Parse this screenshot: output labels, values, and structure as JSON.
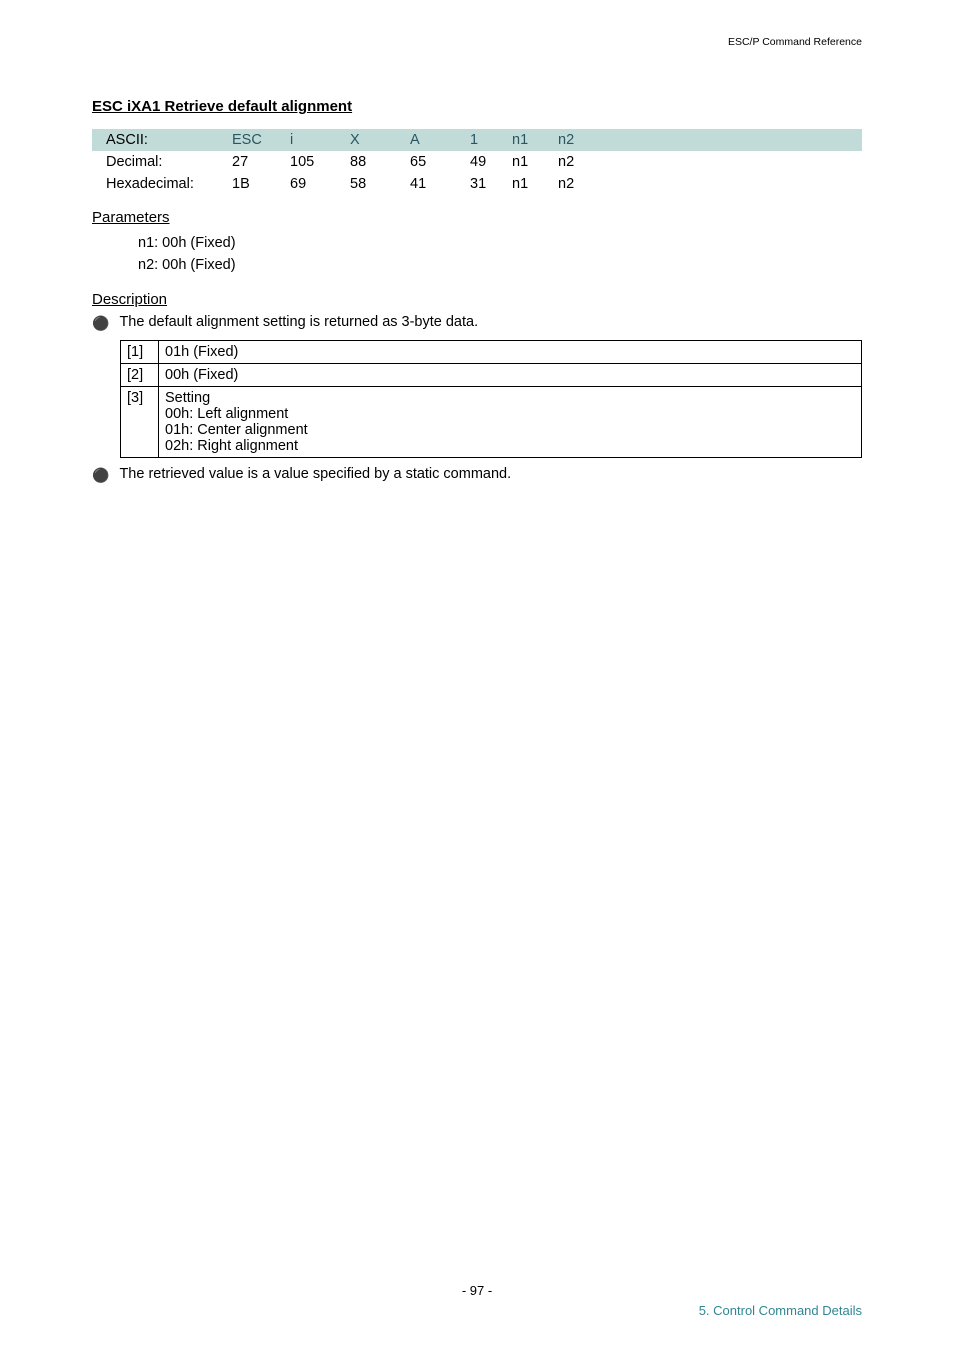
{
  "header": {
    "doc_ref": "ESC/P Command Reference"
  },
  "section": {
    "title": "ESC iXA1   Retrieve default alignment"
  },
  "code_rows": {
    "ascii": {
      "label": "ASCII:",
      "c1": "ESC",
      "c2": "i",
      "c3": "X",
      "c4": "A",
      "c5": "1",
      "c6": "n1",
      "c7": "n2"
    },
    "dec": {
      "label": "Decimal:",
      "c1": "27",
      "c2": "105",
      "c3": "88",
      "c4": "65",
      "c5": "49",
      "c6": "n1",
      "c7": "n2"
    },
    "hex": {
      "label": "Hexadecimal:",
      "c1": "1B",
      "c2": "69",
      "c3": "58",
      "c4": "41",
      "c5": "31",
      "c6": "n1",
      "c7": "n2"
    }
  },
  "parameters": {
    "heading": "Parameters",
    "n1": "n1: 00h (Fixed)",
    "n2": "n2: 00h (Fixed)"
  },
  "description": {
    "heading": "Description",
    "bullet1": "The default alignment setting is returned as 3-byte data.",
    "table": {
      "r1": {
        "idx": "[1]",
        "val": "01h (Fixed)"
      },
      "r2": {
        "idx": "[2]",
        "val": "00h (Fixed)"
      },
      "r3": {
        "idx": "[3]",
        "val": "Setting\n00h: Left alignment\n01h: Center alignment\n02h: Right alignment"
      }
    },
    "bullet2": "The retrieved value is a value specified by a static command."
  },
  "footer": {
    "page": "- 97 -",
    "chapter": "5. Control Command Details"
  }
}
